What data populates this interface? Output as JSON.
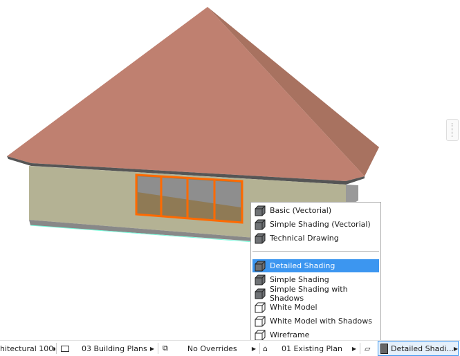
{
  "menu": {
    "items": [
      {
        "label": "Basic (Vectorial)",
        "icon": "basic-vectorial-icon"
      },
      {
        "label": "Simple Shading (Vectorial)",
        "icon": "simple-shading-vectorial-icon"
      },
      {
        "label": "Technical Drawing",
        "icon": "technical-drawing-icon"
      },
      {
        "label": "Detailed Shading",
        "icon": "detailed-shading-icon",
        "selected": true
      },
      {
        "label": "Simple Shading",
        "icon": "simple-shading-icon"
      },
      {
        "label": "Simple Shading with Shadows",
        "icon": "simple-shading-shadows-icon"
      },
      {
        "label": "White Model",
        "icon": "white-model-icon"
      },
      {
        "label": "White Model with Shadows",
        "icon": "white-model-shadows-icon"
      },
      {
        "label": "Wireframe",
        "icon": "wireframe-icon"
      }
    ]
  },
  "status": {
    "scale": "hitectural 100",
    "layer_combo": "03 Building Plans",
    "overrides": "No Overrides",
    "renovation": "01 Existing Plan",
    "style": "Detailed Shadi..."
  },
  "colors": {
    "highlight": "#3c96f0",
    "roof": "#bf8070",
    "wall": "#b4b294",
    "selection": "#ff6a00"
  }
}
